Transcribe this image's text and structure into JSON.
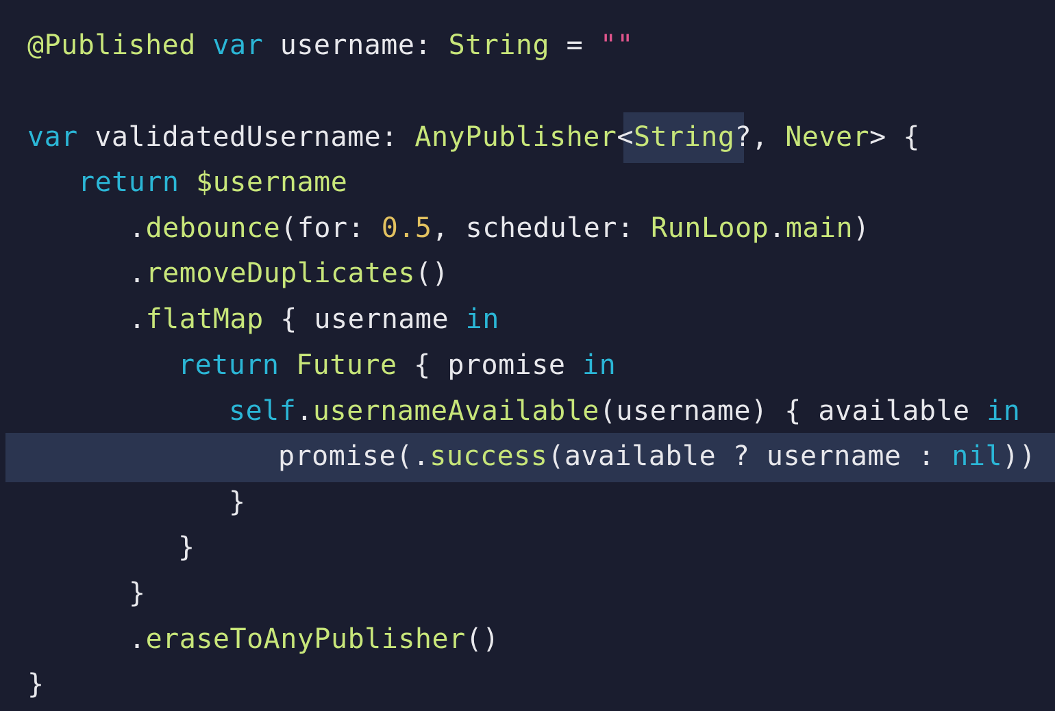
{
  "editor": {
    "theme": {
      "background": "#1a1d2f",
      "highlight": "#2b3550",
      "keyword": "#2bb6d6",
      "type": "#c8e67a",
      "number": "#e2c160",
      "string": "#e0558c",
      "text": "#e8e8ec"
    },
    "lines": [
      [
        {
          "text": "@Published",
          "kind": "ty"
        },
        {
          "text": " ",
          "kind": "txt"
        },
        {
          "text": "var",
          "kind": "kw"
        },
        {
          "text": " username: ",
          "kind": "txt"
        },
        {
          "text": "String",
          "kind": "ty"
        },
        {
          "text": " = ",
          "kind": "txt"
        },
        {
          "text": "\"\"",
          "kind": "str"
        }
      ],
      [],
      [
        {
          "text": "var",
          "kind": "kw"
        },
        {
          "text": " validatedUsername: ",
          "kind": "txt"
        },
        {
          "text": "AnyPublisher",
          "kind": "ty"
        },
        {
          "text": "<",
          "kind": "txt"
        },
        {
          "text": "String",
          "kind": "ty"
        },
        {
          "text": "?, ",
          "kind": "txt"
        },
        {
          "text": "Never",
          "kind": "ty"
        },
        {
          "text": "> {",
          "kind": "txt"
        }
      ],
      [
        {
          "text": "return",
          "kind": "kw"
        },
        {
          "text": " ",
          "kind": "txt"
        },
        {
          "text": "$username",
          "kind": "ty"
        }
      ],
      [
        {
          "text": ".",
          "kind": "txt"
        },
        {
          "text": "debounce",
          "kind": "fn"
        },
        {
          "text": "(for: ",
          "kind": "txt"
        },
        {
          "text": "0.5",
          "kind": "num"
        },
        {
          "text": ", scheduler: ",
          "kind": "txt"
        },
        {
          "text": "RunLoop",
          "kind": "ty"
        },
        {
          "text": ".",
          "kind": "txt"
        },
        {
          "text": "main",
          "kind": "fn"
        },
        {
          "text": ")",
          "kind": "txt"
        }
      ],
      [
        {
          "text": ".",
          "kind": "txt"
        },
        {
          "text": "removeDuplicates",
          "kind": "fn"
        },
        {
          "text": "()",
          "kind": "txt"
        }
      ],
      [
        {
          "text": ".",
          "kind": "txt"
        },
        {
          "text": "flatMap",
          "kind": "fn"
        },
        {
          "text": " { username ",
          "kind": "txt"
        },
        {
          "text": "in",
          "kind": "kw"
        }
      ],
      [
        {
          "text": "return",
          "kind": "kw"
        },
        {
          "text": " ",
          "kind": "txt"
        },
        {
          "text": "Future",
          "kind": "ty"
        },
        {
          "text": " { promise ",
          "kind": "txt"
        },
        {
          "text": "in",
          "kind": "kw"
        }
      ],
      [
        {
          "text": "self",
          "kind": "kw"
        },
        {
          "text": ".",
          "kind": "txt"
        },
        {
          "text": "usernameAvailable",
          "kind": "fn"
        },
        {
          "text": "(username) { available ",
          "kind": "txt"
        },
        {
          "text": "in",
          "kind": "kw"
        }
      ],
      [
        {
          "text": "promise(.",
          "kind": "txt"
        },
        {
          "text": "success",
          "kind": "fn"
        },
        {
          "text": "(available ? username : ",
          "kind": "txt"
        },
        {
          "text": "nil",
          "kind": "kw"
        },
        {
          "text": "))",
          "kind": "txt"
        }
      ],
      [
        {
          "text": "}",
          "kind": "txt"
        }
      ],
      [
        {
          "text": "}",
          "kind": "txt"
        }
      ],
      [
        {
          "text": "}",
          "kind": "txt"
        }
      ],
      [
        {
          "text": ".",
          "kind": "txt"
        },
        {
          "text": "eraseToAnyPublisher",
          "kind": "fn"
        },
        {
          "text": "()",
          "kind": "txt"
        }
      ],
      [
        {
          "text": "}",
          "kind": "txt"
        }
      ]
    ]
  }
}
